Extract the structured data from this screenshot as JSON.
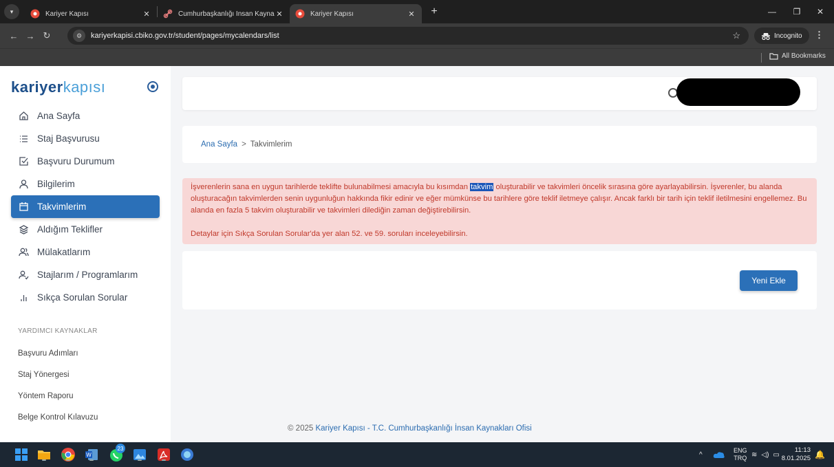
{
  "browser": {
    "tabs": [
      {
        "label": "Kariyer Kapısı",
        "active": false
      },
      {
        "label": "Cumhurbaşkanlığı İnsan Kaynakl",
        "active": false
      },
      {
        "label": "Kariyer Kapısı",
        "active": true
      }
    ],
    "url": "kariyerkapisi.cbiko.gov.tr/student/pages/mycalendars/list",
    "incognito_label": "Incognito",
    "bookmarks_label": "All Bookmarks"
  },
  "sidebar": {
    "logo_part1": "kariyer",
    "logo_part2": "kapısı",
    "items": [
      {
        "label": "Ana Sayfa",
        "icon": "home-icon"
      },
      {
        "label": "Staj Başvurusu",
        "icon": "list-icon"
      },
      {
        "label": "Başvuru Durumum",
        "icon": "checkbox-icon"
      },
      {
        "label": "Bilgilerim",
        "icon": "user-icon"
      },
      {
        "label": "Takvimlerim",
        "icon": "calendar-icon",
        "active": true
      },
      {
        "label": "Aldığım Teklifler",
        "icon": "layers-icon"
      },
      {
        "label": "Mülakatlarım",
        "icon": "users-icon"
      },
      {
        "label": "Stajlarım / Programlarım",
        "icon": "user-check-icon"
      },
      {
        "label": "Sıkça Sorulan Sorular",
        "icon": "bar-chart-icon"
      }
    ],
    "section_title": "YARDIMCI KAYNAKLAR",
    "resources": [
      "Başvuru Adımları",
      "Staj Yönergesi",
      "Yöntem Raporu",
      "Belge Kontrol Kılavuzu"
    ]
  },
  "breadcrumb": {
    "home": "Ana Sayfa",
    "separator": ">",
    "current": "Takvimlerim"
  },
  "alert": {
    "p1_before": "İşverenlerin sana en uygun tarihlerde teklifte bulunabilmesi amacıyla bu kısımdan ",
    "p1_highlight": "takvim",
    "p1_after": " oluşturabilir ve takvimleri öncelik sırasına göre ayarlayabilirsin. İşverenler, bu alanda oluşturacağın takvimlerden senin uygunluğun hakkında fikir edinir ve eğer mümkünse bu tarihlere göre teklif iletmeye çalışır. Ancak farklı bir tarih için teklif iletilmesini engellemez. Bu alanda en fazla 5 takvim oluşturabilir ve takvimleri dilediğin zaman değiştirebilirsin.",
    "p2": "Detaylar için Sıkça Sorulan Sorular'da yer alan 52. ve 59. soruları inceleyebilirsin."
  },
  "add_button": "Yeni Ekle",
  "footer": {
    "prefix": "© 2025",
    "link": "Kariyer Kapısı - T.C. Cumhurbaşkanlığı İnsan Kaynakları Ofisi"
  },
  "taskbar": {
    "lang_top": "ENG",
    "lang_bottom": "TRQ",
    "time": "11:13",
    "date": "8.01.2025",
    "whatsapp_badge": "23"
  },
  "colors": {
    "accent": "#2b70b8",
    "alert_bg": "#f8d7d6",
    "alert_text": "#c0392b"
  }
}
